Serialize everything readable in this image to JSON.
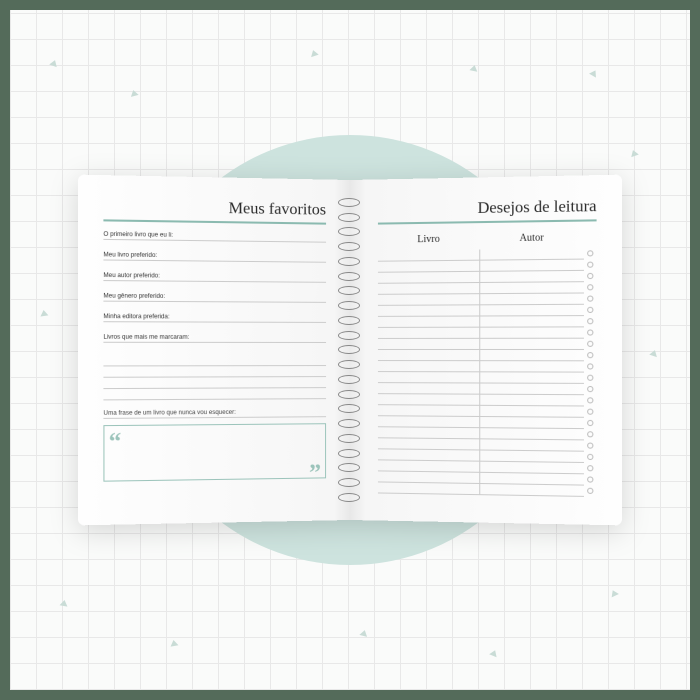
{
  "left_page": {
    "title": "Meus favoritos",
    "prompts": [
      "O primeiro livro que eu li:",
      "Meu livro preferido:",
      "Meu autor preferido:",
      "Meu gênero preferido:",
      "Minha editora preferida:",
      "Livros que mais me marcaram:"
    ],
    "quote_prompt": "Uma frase de um livro que nunca vou esquecer:"
  },
  "right_page": {
    "title": "Desejos de leitura",
    "col1": "Livro",
    "col2": "Autor"
  },
  "colors": {
    "accent": "#9cc4bb",
    "circle_bg": "#cde3de",
    "frame": "#546b5a"
  }
}
